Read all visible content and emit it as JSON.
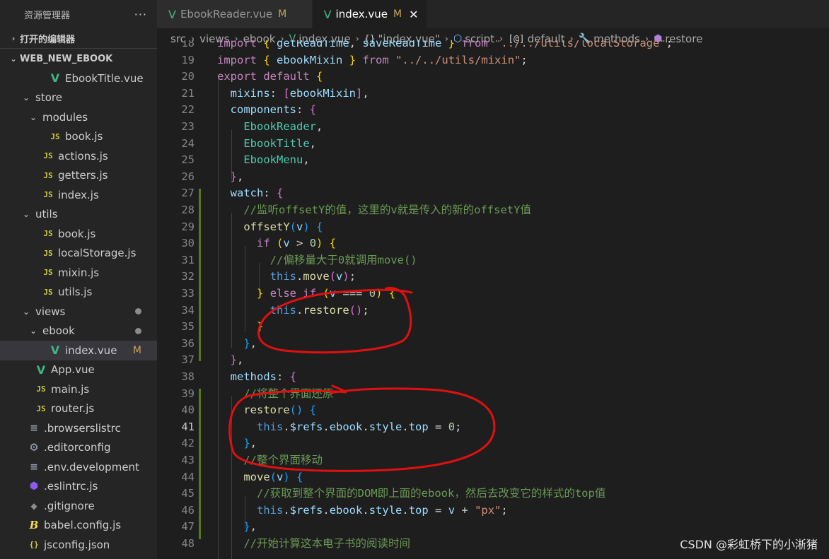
{
  "sidebar": {
    "title": "资源管理器",
    "more": "···",
    "open_editors": "打开的编辑器",
    "project": "WEB_NEW_EBOOK",
    "items": [
      {
        "label": "EbookTitle.vue",
        "icon": "vue-icon",
        "indent": 3,
        "chevron": ""
      },
      {
        "label": "store",
        "icon": "",
        "indent": 1,
        "chevron": "⌄"
      },
      {
        "label": "modules",
        "icon": "",
        "indent": 2,
        "chevron": "⌄"
      },
      {
        "label": "book.js",
        "icon": "js-icon",
        "indent": 3,
        "chevron": ""
      },
      {
        "label": "actions.js",
        "icon": "js-icon",
        "indent": 2,
        "chevron": ""
      },
      {
        "label": "getters.js",
        "icon": "js-icon",
        "indent": 2,
        "chevron": ""
      },
      {
        "label": "index.js",
        "icon": "js-icon",
        "indent": 2,
        "chevron": ""
      },
      {
        "label": "utils",
        "icon": "",
        "indent": 1,
        "chevron": "⌄"
      },
      {
        "label": "book.js",
        "icon": "js-icon",
        "indent": 2,
        "chevron": ""
      },
      {
        "label": "localStorage.js",
        "icon": "js-icon",
        "indent": 2,
        "chevron": ""
      },
      {
        "label": "mixin.js",
        "icon": "js-icon",
        "indent": 2,
        "chevron": ""
      },
      {
        "label": "utils.js",
        "icon": "js-icon",
        "indent": 2,
        "chevron": ""
      },
      {
        "label": "views",
        "icon": "",
        "indent": 1,
        "chevron": "⌄",
        "modified_dot": true
      },
      {
        "label": "ebook",
        "icon": "",
        "indent": 2,
        "chevron": "⌄",
        "modified_dot": true
      },
      {
        "label": "index.vue",
        "icon": "vue-icon",
        "indent": 3,
        "chevron": "",
        "selected": true,
        "badge": "M"
      },
      {
        "label": "App.vue",
        "icon": "vue-icon",
        "indent": 1,
        "chevron": ""
      },
      {
        "label": "main.js",
        "icon": "js-icon",
        "indent": 1,
        "chevron": ""
      },
      {
        "label": "router.js",
        "icon": "js-icon",
        "indent": 1,
        "chevron": ""
      },
      {
        "label": ".browserslistrc",
        "icon": "lines-icon",
        "indent": 0,
        "chevron": ""
      },
      {
        "label": ".editorconfig",
        "icon": "gear-icon",
        "indent": 0,
        "chevron": ""
      },
      {
        "label": ".env.development",
        "icon": "lines-icon",
        "indent": 0,
        "chevron": ""
      },
      {
        "label": ".eslintrc.js",
        "icon": "eslint-icon",
        "indent": 0,
        "chevron": ""
      },
      {
        "label": ".gitignore",
        "icon": "git-icon",
        "indent": 0,
        "chevron": ""
      },
      {
        "label": "babel.config.js",
        "icon": "babel-icon",
        "indent": 0,
        "chevron": ""
      },
      {
        "label": "jsconfig.json",
        "icon": "json-icon",
        "indent": 0,
        "chevron": ""
      }
    ]
  },
  "tabs": [
    {
      "label": "EbookReader.vue",
      "badge": "M",
      "active": false
    },
    {
      "label": "index.vue",
      "badge": "M",
      "active": true
    }
  ],
  "breadcrumb": [
    {
      "label": "src",
      "icon": ""
    },
    {
      "label": "views",
      "icon": ""
    },
    {
      "label": "ebook",
      "icon": ""
    },
    {
      "label": "index.vue",
      "icon": "vue"
    },
    {
      "label": "\"index.vue\"",
      "icon": "brace"
    },
    {
      "label": "script",
      "icon": "cube"
    },
    {
      "label": "default",
      "icon": "brace2"
    },
    {
      "label": "methods",
      "icon": "wrench"
    },
    {
      "label": "restore",
      "icon": "method"
    }
  ],
  "editor": {
    "current_line": 41,
    "lines": [
      {
        "n": 18,
        "tokens": [
          [
            "k",
            "import"
          ],
          [
            "p",
            " "
          ],
          [
            "b1",
            "{"
          ],
          [
            "v",
            " getReadTime"
          ],
          [
            "p",
            ", "
          ],
          [
            "v",
            "saveReadTime"
          ],
          [
            "p",
            " "
          ],
          [
            "b1",
            "}"
          ],
          [
            "p",
            " "
          ],
          [
            "k",
            "from"
          ],
          [
            "p",
            " "
          ],
          [
            "s",
            "\"../../utils/localStorage\""
          ],
          [
            "p",
            ";"
          ]
        ]
      },
      {
        "n": 19,
        "tokens": [
          [
            "k",
            "import"
          ],
          [
            "p",
            " "
          ],
          [
            "b1",
            "{"
          ],
          [
            "p",
            " "
          ],
          [
            "v",
            "ebookMixin"
          ],
          [
            "p",
            " "
          ],
          [
            "b1",
            "}"
          ],
          [
            "p",
            " "
          ],
          [
            "k",
            "from"
          ],
          [
            "p",
            " "
          ],
          [
            "s",
            "\"../../utils/mixin\""
          ],
          [
            "p",
            ";"
          ]
        ]
      },
      {
        "n": 20,
        "tokens": [
          [
            "k",
            "export"
          ],
          [
            "p",
            " "
          ],
          [
            "k",
            "default"
          ],
          [
            "p",
            " "
          ],
          [
            "b1",
            "{"
          ]
        ]
      },
      {
        "n": 21,
        "tokens": [
          [
            "p",
            "  "
          ],
          [
            "v",
            "mixins"
          ],
          [
            "p",
            ": "
          ],
          [
            "b2",
            "["
          ],
          [
            "v",
            "ebookMixin"
          ],
          [
            "b2",
            "]"
          ],
          [
            "p",
            ","
          ]
        ]
      },
      {
        "n": 22,
        "tokens": [
          [
            "p",
            "  "
          ],
          [
            "v",
            "components"
          ],
          [
            "p",
            ": "
          ],
          [
            "b2",
            "{"
          ]
        ]
      },
      {
        "n": 23,
        "tokens": [
          [
            "p",
            "    "
          ],
          [
            "t",
            "EbookReader"
          ],
          [
            "p",
            ","
          ]
        ]
      },
      {
        "n": 24,
        "tokens": [
          [
            "p",
            "    "
          ],
          [
            "t",
            "EbookTitle"
          ],
          [
            "p",
            ","
          ]
        ]
      },
      {
        "n": 25,
        "tokens": [
          [
            "p",
            "    "
          ],
          [
            "t",
            "EbookMenu"
          ],
          [
            "p",
            ","
          ]
        ]
      },
      {
        "n": 26,
        "tokens": [
          [
            "p",
            "  "
          ],
          [
            "b2",
            "}"
          ],
          [
            "p",
            ","
          ]
        ]
      },
      {
        "n": 27,
        "tokens": [
          [
            "p",
            "  "
          ],
          [
            "v",
            "watch"
          ],
          [
            "p",
            ": "
          ],
          [
            "b2",
            "{"
          ]
        ]
      },
      {
        "n": 28,
        "tokens": [
          [
            "p",
            "    "
          ],
          [
            "c",
            "//监听offsetY的值，这里的v就是传入的新的offsetY值"
          ]
        ]
      },
      {
        "n": 29,
        "tokens": [
          [
            "p",
            "    "
          ],
          [
            "f",
            "offsetY"
          ],
          [
            "b3",
            "("
          ],
          [
            "v",
            "v"
          ],
          [
            "b3",
            ")"
          ],
          [
            "p",
            " "
          ],
          [
            "b3",
            "{"
          ]
        ]
      },
      {
        "n": 30,
        "tokens": [
          [
            "p",
            "      "
          ],
          [
            "k",
            "if"
          ],
          [
            "p",
            " "
          ],
          [
            "b1",
            "("
          ],
          [
            "v",
            "v"
          ],
          [
            "p",
            " > "
          ],
          [
            "n",
            "0"
          ],
          [
            "b1",
            ")"
          ],
          [
            "p",
            " "
          ],
          [
            "b1",
            "{"
          ]
        ]
      },
      {
        "n": 31,
        "tokens": [
          [
            "p",
            "        "
          ],
          [
            "c",
            "//偏移量大于0就调用move()"
          ]
        ]
      },
      {
        "n": 32,
        "tokens": [
          [
            "p",
            "        "
          ],
          [
            "kb",
            "this"
          ],
          [
            "p",
            "."
          ],
          [
            "f",
            "move"
          ],
          [
            "b2",
            "("
          ],
          [
            "v",
            "v"
          ],
          [
            "b2",
            ")"
          ],
          [
            "p",
            ";"
          ]
        ]
      },
      {
        "n": 33,
        "tokens": [
          [
            "p",
            "      "
          ],
          [
            "b1",
            "}"
          ],
          [
            "p",
            " "
          ],
          [
            "k",
            "else"
          ],
          [
            "p",
            " "
          ],
          [
            "k",
            "if"
          ],
          [
            "p",
            " "
          ],
          [
            "b1",
            "("
          ],
          [
            "v",
            "v"
          ],
          [
            "p",
            " === "
          ],
          [
            "n",
            "0"
          ],
          [
            "b1",
            ")"
          ],
          [
            "p",
            " "
          ],
          [
            "b1",
            "{"
          ]
        ]
      },
      {
        "n": 34,
        "tokens": [
          [
            "p",
            "        "
          ],
          [
            "kb",
            "this"
          ],
          [
            "p",
            "."
          ],
          [
            "f",
            "restore"
          ],
          [
            "b2",
            "()"
          ],
          [
            "p",
            ";"
          ]
        ]
      },
      {
        "n": 35,
        "tokens": [
          [
            "p",
            "      "
          ],
          [
            "b1",
            "}"
          ]
        ]
      },
      {
        "n": 36,
        "tokens": [
          [
            "p",
            "    "
          ],
          [
            "b3",
            "}"
          ],
          [
            "p",
            ","
          ]
        ]
      },
      {
        "n": 37,
        "tokens": [
          [
            "p",
            "  "
          ],
          [
            "b2",
            "}"
          ],
          [
            "p",
            ","
          ]
        ]
      },
      {
        "n": 38,
        "tokens": [
          [
            "p",
            "  "
          ],
          [
            "v",
            "methods"
          ],
          [
            "p",
            ": "
          ],
          [
            "b2",
            "{"
          ]
        ]
      },
      {
        "n": 39,
        "tokens": [
          [
            "p",
            "    "
          ],
          [
            "c",
            "//将整个界面还原"
          ]
        ]
      },
      {
        "n": 40,
        "tokens": [
          [
            "p",
            "    "
          ],
          [
            "f",
            "restore"
          ],
          [
            "b3",
            "()"
          ],
          [
            "p",
            " "
          ],
          [
            "b3",
            "{"
          ]
        ]
      },
      {
        "n": 41,
        "tokens": [
          [
            "p",
            "      "
          ],
          [
            "kb",
            "this"
          ],
          [
            "p",
            "."
          ],
          [
            "v",
            "$refs"
          ],
          [
            "p",
            "."
          ],
          [
            "v",
            "ebook"
          ],
          [
            "p",
            "."
          ],
          [
            "v",
            "style"
          ],
          [
            "p",
            "."
          ],
          [
            "v",
            "top"
          ],
          [
            "p",
            " = "
          ],
          [
            "n",
            "0"
          ],
          [
            "p",
            ";"
          ]
        ]
      },
      {
        "n": 42,
        "tokens": [
          [
            "p",
            "    "
          ],
          [
            "b3",
            "}"
          ],
          [
            "p",
            ","
          ]
        ]
      },
      {
        "n": 43,
        "tokens": [
          [
            "p",
            "    "
          ],
          [
            "c",
            "//整个界面移动"
          ]
        ]
      },
      {
        "n": 44,
        "tokens": [
          [
            "p",
            "    "
          ],
          [
            "f",
            "move"
          ],
          [
            "b3",
            "("
          ],
          [
            "v",
            "v"
          ],
          [
            "b3",
            ")"
          ],
          [
            "p",
            " "
          ],
          [
            "b3",
            "{"
          ]
        ]
      },
      {
        "n": 45,
        "tokens": [
          [
            "p",
            "      "
          ],
          [
            "c",
            "//获取到整个界面的DOM即上面的ebook，然后去改变它的样式的top值"
          ]
        ]
      },
      {
        "n": 46,
        "tokens": [
          [
            "p",
            "      "
          ],
          [
            "kb",
            "this"
          ],
          [
            "p",
            "."
          ],
          [
            "v",
            "$refs"
          ],
          [
            "p",
            "."
          ],
          [
            "v",
            "ebook"
          ],
          [
            "p",
            "."
          ],
          [
            "v",
            "style"
          ],
          [
            "p",
            "."
          ],
          [
            "v",
            "top"
          ],
          [
            "p",
            " = "
          ],
          [
            "v",
            "v"
          ],
          [
            "p",
            " + "
          ],
          [
            "s",
            "\"px\""
          ],
          [
            "p",
            ";"
          ]
        ]
      },
      {
        "n": 47,
        "tokens": [
          [
            "p",
            "    "
          ],
          [
            "b3",
            "}"
          ],
          [
            "p",
            ","
          ]
        ]
      },
      {
        "n": 48,
        "tokens": [
          [
            "p",
            "    "
          ],
          [
            "c",
            "//开始计算这本电子书的阅读时间"
          ]
        ]
      }
    ]
  },
  "watermark": "CSDN @彩虹桥下的小淅猪",
  "colors": {
    "annotation": "#e01010",
    "accent_vue": "#41b883",
    "modified": "#c5a35a"
  }
}
